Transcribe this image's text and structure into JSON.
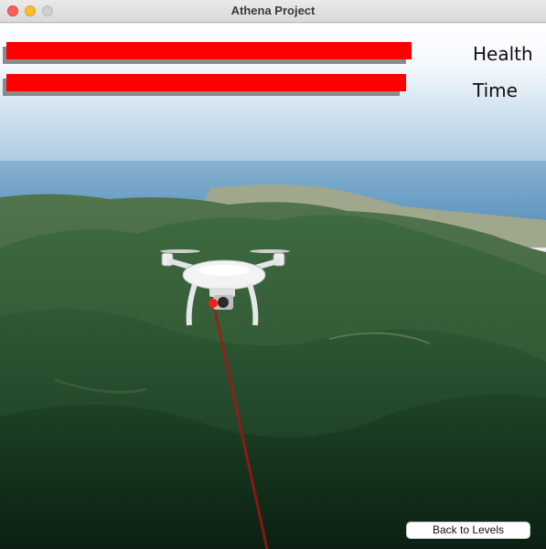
{
  "window": {
    "title": "Athena Project"
  },
  "hud": {
    "health_label": "Health",
    "time_label": "Time",
    "health_level": 0.75,
    "time_level": 0.74,
    "bar_color": "#ff0000"
  },
  "controls": {
    "back_label": "Back to Levels"
  },
  "icons": [
    "close-icon",
    "minimize-icon",
    "zoom-icon",
    "drone-icon",
    "laser-beam-icon"
  ]
}
